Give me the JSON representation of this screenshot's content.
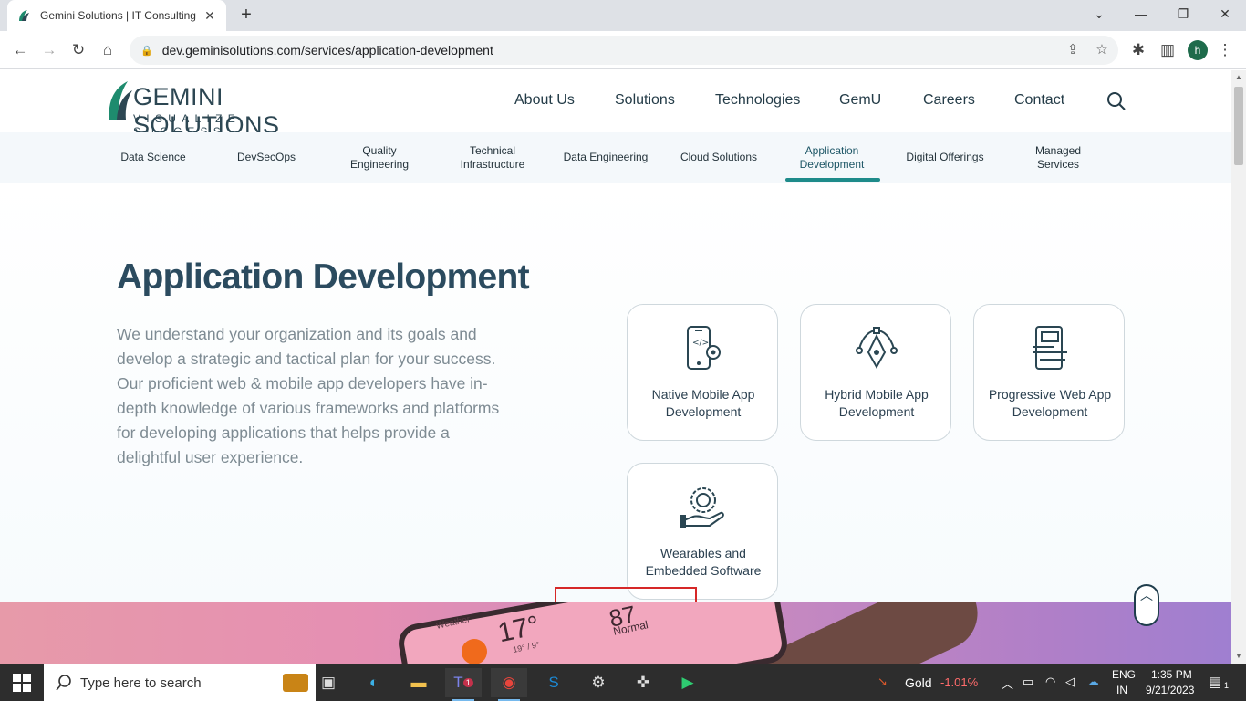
{
  "browser": {
    "tab_title": "Gemini Solutions | IT Consulting",
    "tab_close": "✕",
    "new_tab": "+",
    "url": "dev.geminisolutions.com/services/application-development"
  },
  "site": {
    "logo_wordmark": "GEMINI SOLUTIONS",
    "logo_tagline": "VISUALIZE SUCCESS",
    "nav": [
      "About Us",
      "Solutions",
      "Technologies",
      "GemU",
      "Careers",
      "Contact"
    ],
    "subnav": [
      "Data Science",
      "DevSecOps",
      "Quality Engineering",
      "Technical Infrastructure",
      "Data Engineering",
      "Cloud Solutions",
      "Application Development",
      "Digital Offerings",
      "Managed Services"
    ],
    "active_subnav": "Application Development",
    "accent_color": "#1e8b8a",
    "heading_color": "#2b4b5f"
  },
  "hero": {
    "title": "Application Development",
    "body": "We understand your organization and its goals and develop a strategic and tactical plan for your success. Our proficient web & mobile app developers have in-depth knowledge of various frameworks and platforms for developing applications that helps provide a delightful user experience."
  },
  "cards": [
    {
      "label": "Native Mobile App Development",
      "icon": "mobile-code-icon"
    },
    {
      "label": "Hybrid Mobile App Development",
      "icon": "pen-tool-icon"
    },
    {
      "label": "Progressive Web App Development",
      "icon": "web-app-icon"
    },
    {
      "label": "Wearables and Embedded Software",
      "icon": "hand-gear-icon"
    }
  ],
  "banner": {
    "weather_label": "Weather",
    "weather_temp": "17°",
    "weather_low": "19° / 9°",
    "metric_value": "87",
    "metric_label": "Normal"
  },
  "taskbar": {
    "search_placeholder": "Type here to search",
    "ticker_name": "Gold",
    "ticker_change": "-1.01%",
    "lang_top": "ENG",
    "lang_bottom": "IN",
    "time": "1:35 PM",
    "date": "9/21/2023",
    "notif_count": "1",
    "teams_badge": "1"
  }
}
